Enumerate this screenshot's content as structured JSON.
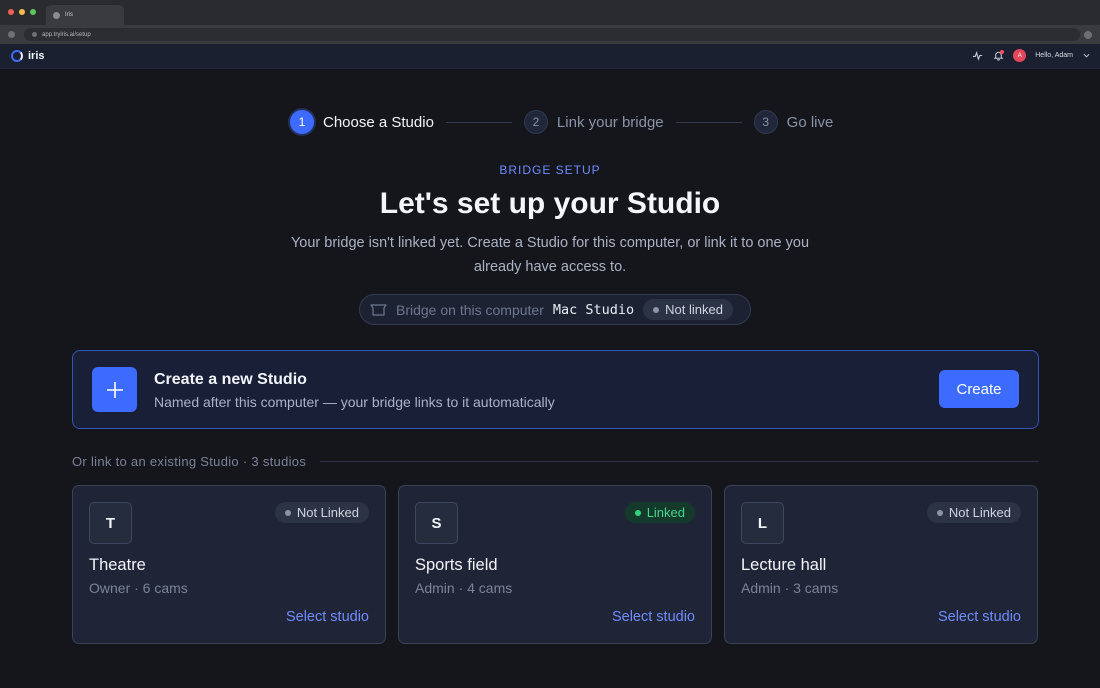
{
  "browser": {
    "tab_title": "Iris",
    "url": "app.tryiris.ai/setup"
  },
  "header": {
    "brand": "iris",
    "greeting": "Hello, Adam",
    "avatar_initial": "A"
  },
  "stepper": {
    "steps": [
      {
        "number": "1",
        "label": "Choose a Studio",
        "state": "active"
      },
      {
        "number": "2",
        "label": "Link your bridge",
        "state": "inactive"
      },
      {
        "number": "3",
        "label": "Go live",
        "state": "inactive"
      }
    ]
  },
  "hero": {
    "eyebrow": "BRIDGE SETUP",
    "title": "Let's set up your Studio",
    "subtitle": "Your bridge isn't linked yet. Create a Studio for this computer, or link it to one you already have access to."
  },
  "bridge_pill": {
    "label": "Bridge on this computer",
    "computer": "Mac Studio",
    "status": "Not linked"
  },
  "create_card": {
    "title": "Create a new Studio",
    "subtitle": "Named after this computer — your bridge links to it automatically",
    "button": "Create"
  },
  "existing": {
    "heading": "Or link to an existing Studio · 3 studios",
    "studios": [
      {
        "initial": "T",
        "name": "Theatre",
        "meta": "Owner · 6 cams",
        "status": "Not Linked",
        "linked": false,
        "action": "Select studio"
      },
      {
        "initial": "S",
        "name": "Sports field",
        "meta": "Admin · 4 cams",
        "status": "Linked",
        "linked": true,
        "action": "Select studio"
      },
      {
        "initial": "L",
        "name": "Lecture hall",
        "meta": "Admin · 3 cams",
        "status": "Not Linked",
        "linked": false,
        "action": "Select studio"
      }
    ]
  },
  "colors": {
    "accent": "#3d6bff",
    "background": "#14161c",
    "linked_green": "#38d27e"
  }
}
